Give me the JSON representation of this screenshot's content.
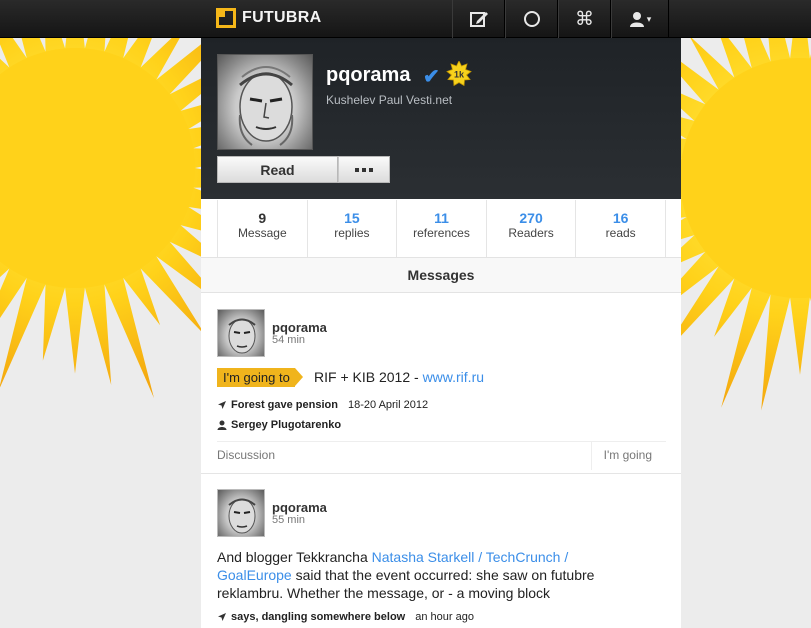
{
  "brand": {
    "name": "FUTUBRA",
    "accent": "#f5b719"
  },
  "nav": {
    "items": [
      {
        "icon": "compose-icon",
        "glyph": "✎"
      },
      {
        "icon": "circle-icon",
        "glyph": "○"
      },
      {
        "icon": "command-icon",
        "glyph": "⌘"
      },
      {
        "icon": "user-menu-icon",
        "glyph": "▾"
      }
    ]
  },
  "profile": {
    "username": "pqorama",
    "verified_glyph": "✔",
    "badge": "1k",
    "subtitle": "Kushelev Paul Vesti.net",
    "read_button": "Read"
  },
  "stats": [
    {
      "value": "9",
      "label": "Message"
    },
    {
      "value": "15",
      "label": "replies"
    },
    {
      "value": "11",
      "label": "references"
    },
    {
      "value": "270",
      "label": "Readers"
    },
    {
      "value": "16",
      "label": "reads"
    }
  ],
  "messages_header": "Messages",
  "posts": [
    {
      "user": "pqorama",
      "time": "54 min",
      "tag": "I'm going to",
      "text_plain": "RIF + KIB 2012 - ",
      "text_link": "www.rif.ru",
      "location": "Forest gave pension",
      "date": "18-20 April 2012",
      "person": "Sergey Plugotarenko",
      "discussion": "Discussion",
      "going": "I'm going"
    },
    {
      "user": "pqorama",
      "time": "55 min",
      "text_a": "And blogger Tekkrancha ",
      "link_a": "Natasha Starkell / TechCrunch /",
      "link_b": "GoalEurope",
      "text_b": " said that the event occurred: she saw on futubre",
      "text_c": "reklambru. Whether the message, or - a moving block",
      "says": "says, dangling somewhere below",
      "says_time": "an hour ago"
    }
  ]
}
